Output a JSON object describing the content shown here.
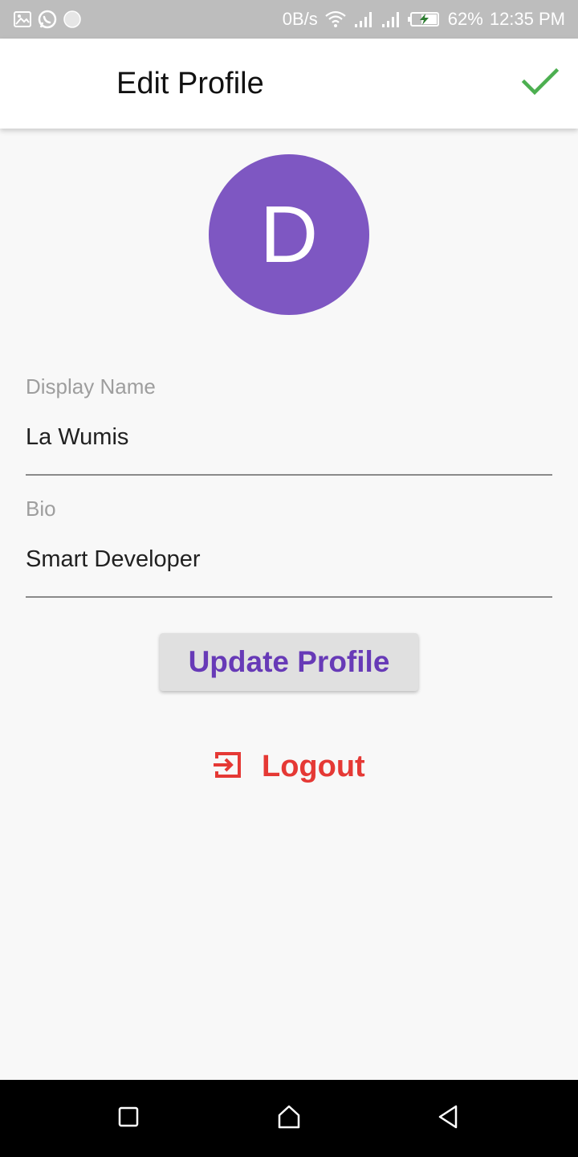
{
  "status_bar": {
    "net_speed": "0B/s",
    "battery": "62%",
    "time": "12:35 PM",
    "icons_left": [
      "image-icon",
      "whatsapp-icon",
      "notification-dot-icon"
    ],
    "icons_right": [
      "wifi-icon",
      "signal-icon",
      "signal-icon",
      "battery-charging-icon"
    ]
  },
  "app_bar": {
    "title": "Edit Profile",
    "confirm_icon": "check-icon",
    "confirm_color": "#4caf50"
  },
  "avatar": {
    "initial": "D",
    "color": "#7e57c2"
  },
  "fields": {
    "display_name": {
      "label": "Display Name",
      "value": "La Wumis"
    },
    "bio": {
      "label": "Bio",
      "value": "Smart Developer"
    }
  },
  "actions": {
    "update_label": "Update Profile",
    "update_color": "#673ab7",
    "logout_label": "Logout",
    "logout_icon": "exit-icon",
    "logout_color": "#e53935"
  },
  "nav_bar": {
    "buttons": [
      "recents-icon",
      "home-icon",
      "back-icon"
    ]
  }
}
